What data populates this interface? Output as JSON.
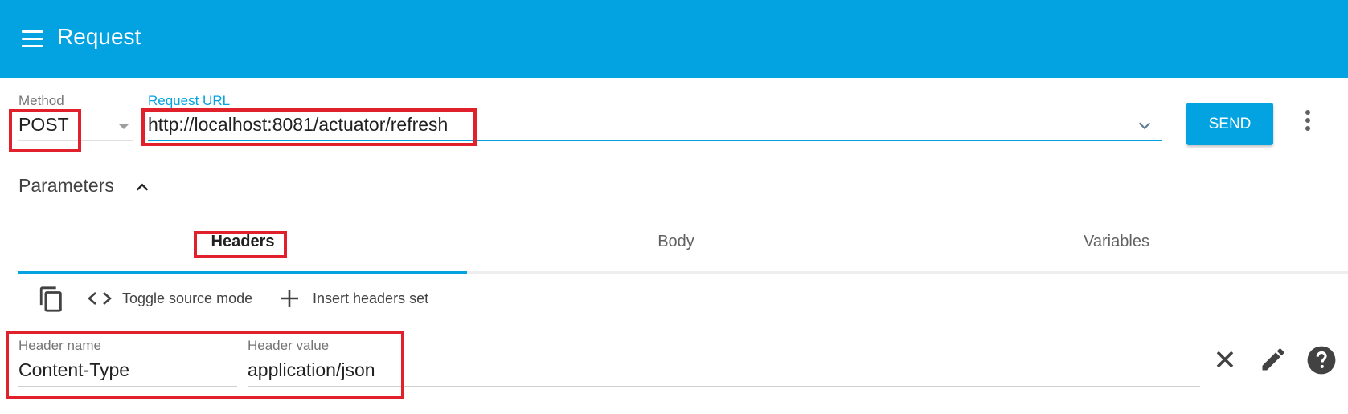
{
  "app_bar": {
    "title": "Request",
    "menu_icon": "menu-icon"
  },
  "request": {
    "method_label": "Method",
    "method_value": "POST",
    "url_label": "Request URL",
    "url_value": "http://localhost:8081/actuator/refresh",
    "send_label": "SEND"
  },
  "parameters": {
    "label": "Parameters",
    "tabs": [
      {
        "label": "Headers",
        "active": true
      },
      {
        "label": "Body",
        "active": false
      },
      {
        "label": "Variables",
        "active": false
      }
    ]
  },
  "toolbar": {
    "toggle_source": "Toggle source mode",
    "insert_headers": "Insert headers set"
  },
  "header_row": {
    "name_label": "Header name",
    "name_value": "Content-Type",
    "value_label": "Header value",
    "value_value": "application/json"
  },
  "colors": {
    "accent": "#03a3e1",
    "highlight": "#e0202a"
  }
}
